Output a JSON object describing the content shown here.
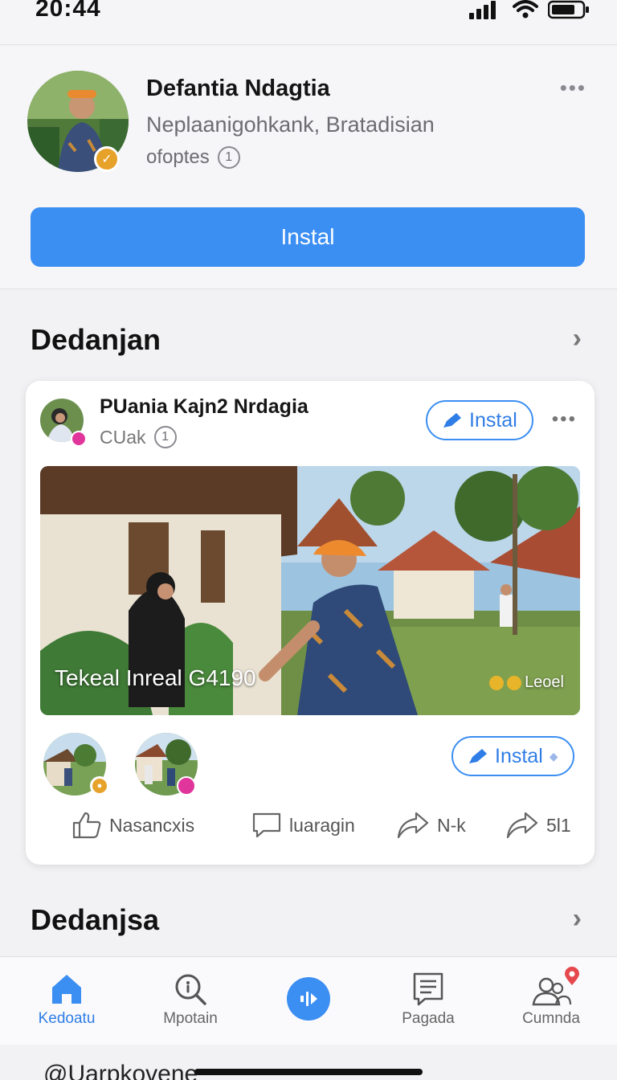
{
  "status": {
    "time": "20:44"
  },
  "profile": {
    "name": "Defantia Ndagtia",
    "location": "Neplaanigohkank, Bratadisian",
    "meta": "ofoptes",
    "meta_count": "1",
    "action_label": "Instal"
  },
  "section1": {
    "title": "Dedanjan"
  },
  "post": {
    "author": "PUania Kajn2 Nrdagia",
    "sub": "CUak",
    "sub_count": "1",
    "follow_label": "Instal",
    "photo_caption": "Tekeal Inreal G4190",
    "photo_tag": "Leoel",
    "second_label": "Instal",
    "actions": {
      "like": "Nasancxis",
      "comment": "luaragin",
      "share": "N-k",
      "repost": "5l1"
    }
  },
  "section2": {
    "title": "Dedanjsa"
  },
  "nav": {
    "home": "Kedoatu",
    "search": "Mpotain",
    "pages": "Pagada",
    "community": "Cumnda"
  },
  "under": {
    "text": "@Uarpkovene"
  },
  "colors": {
    "accent": "#3b8ef2",
    "badge_gold": "#e7a22a",
    "badge_pink": "#e0359b",
    "notif_red": "#e5484d"
  }
}
